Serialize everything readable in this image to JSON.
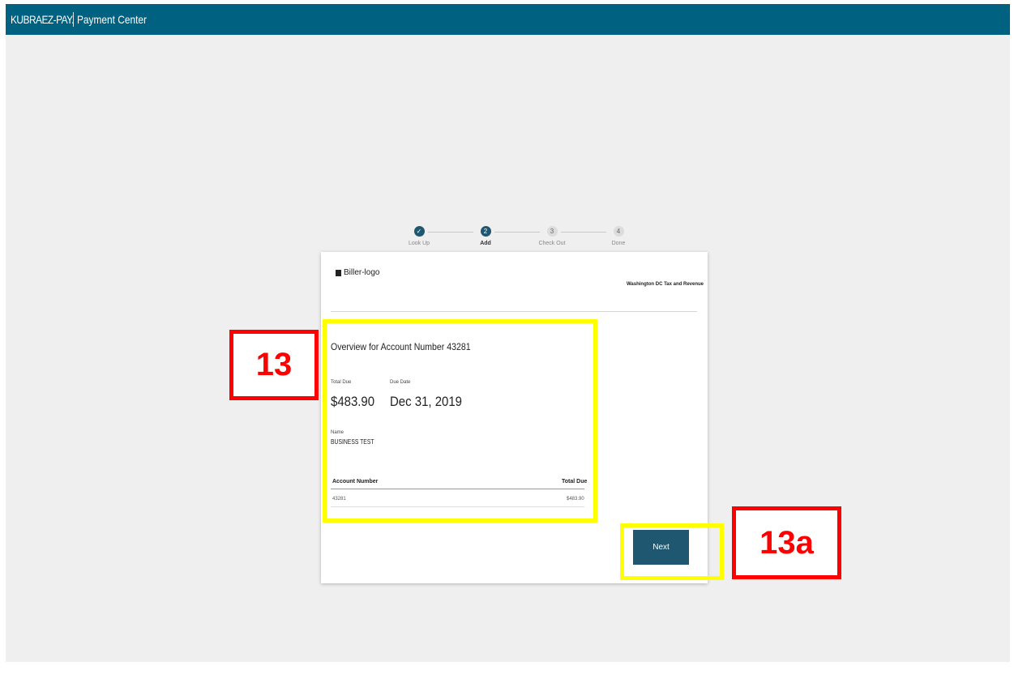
{
  "header": {
    "brand": "KUBRAEZ-PAY.",
    "app_title": "Payment Center"
  },
  "stepper": {
    "steps": [
      {
        "number": "✓",
        "label": "Look Up",
        "state": "done"
      },
      {
        "number": "2",
        "label": "Add",
        "state": "active"
      },
      {
        "number": "3",
        "label": "Check Out",
        "state": "todo"
      },
      {
        "number": "4",
        "label": "Done",
        "state": "todo"
      }
    ]
  },
  "card": {
    "logo_text": "Biller-logo",
    "biller_name": "Washington DC Tax and Revenue",
    "overview_title": "Overview for Account Number 43281",
    "total_due_label": "Total Due",
    "total_due_value": "$483.90",
    "due_date_label": "Due Date",
    "due_date_value": "Dec 31, 2019",
    "name_label": "Name",
    "name_value": "BUSINESS TEST",
    "table": {
      "headers": [
        "Account Number",
        "Total Due"
      ],
      "rows": [
        [
          "43281",
          "$483.90"
        ]
      ]
    },
    "next_button": "Next"
  },
  "annotations": {
    "label_main": "13",
    "label_button": "13a"
  },
  "colors": {
    "header_bg": "#006280",
    "accent": "#1f5670",
    "highlight": "#ffff00",
    "annotation": "#ff0000"
  }
}
